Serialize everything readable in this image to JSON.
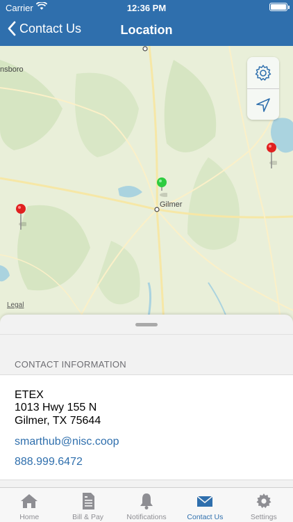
{
  "status_bar": {
    "carrier": "Carrier",
    "time": "12:36 PM"
  },
  "nav": {
    "back_label": "Contact Us",
    "title": "Location"
  },
  "map": {
    "towns": [
      "Gilmer",
      "nsboro"
    ],
    "legal_label": "Legal",
    "controls": [
      "gear-icon",
      "location-arrow-icon"
    ],
    "pins": [
      {
        "color": "#e02020",
        "kind": "office"
      },
      {
        "color": "#e02020",
        "kind": "office"
      },
      {
        "color": "#2ecc40",
        "kind": "current-location"
      }
    ]
  },
  "contact": {
    "section_header": "CONTACT INFORMATION",
    "name": "ETEX",
    "address_line1": "1013 Hwy 155 N",
    "address_line2": "Gilmer, TX 75644",
    "email": "smarthub@nisc.coop",
    "phone": "888.999.6472"
  },
  "tabs": [
    {
      "label": "Home",
      "icon": "home-icon",
      "active": false
    },
    {
      "label": "Bill & Pay",
      "icon": "bill-icon",
      "active": false
    },
    {
      "label": "Notifications",
      "icon": "bell-icon",
      "active": false
    },
    {
      "label": "Contact Us",
      "icon": "envelope-icon",
      "active": true
    },
    {
      "label": "Settings",
      "icon": "gear-icon",
      "active": false
    }
  ],
  "colors": {
    "accent": "#2f6fad",
    "tab_inactive": "#8e8e93",
    "map_bg": "#e9efd9"
  }
}
